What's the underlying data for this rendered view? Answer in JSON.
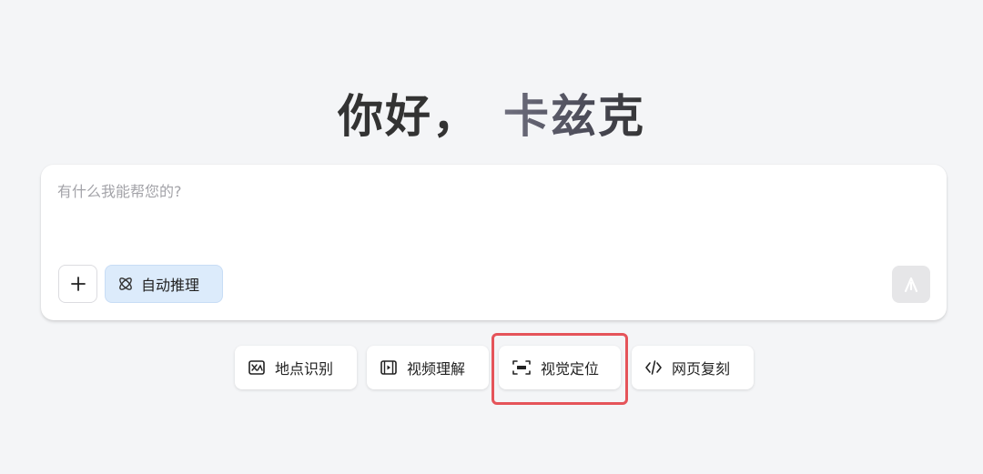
{
  "greeting": {
    "hello": "你好，",
    "username": "卡兹克"
  },
  "composer": {
    "placeholder": "有什么我能帮您的?",
    "value": "",
    "add_icon": "plus-icon",
    "reasoning_chip": {
      "label": "自动推理",
      "icon": "atom-icon",
      "active": true
    },
    "send_icon": "send-arrow-icon",
    "send_enabled": false
  },
  "tools": [
    {
      "label": "地点识别",
      "icon": "map-location-icon"
    },
    {
      "label": "视频理解",
      "icon": "video-icon"
    },
    {
      "label": "视觉定位",
      "icon": "visual-grounding-icon"
    },
    {
      "label": "网页复刻",
      "icon": "code-icon"
    }
  ],
  "highlight": {
    "target": "视觉定位",
    "color": "#e5545a"
  },
  "colors": {
    "background": "#f4f5f7",
    "chip_active": "#dcebfb",
    "send_disabled": "#e6e6e8"
  }
}
